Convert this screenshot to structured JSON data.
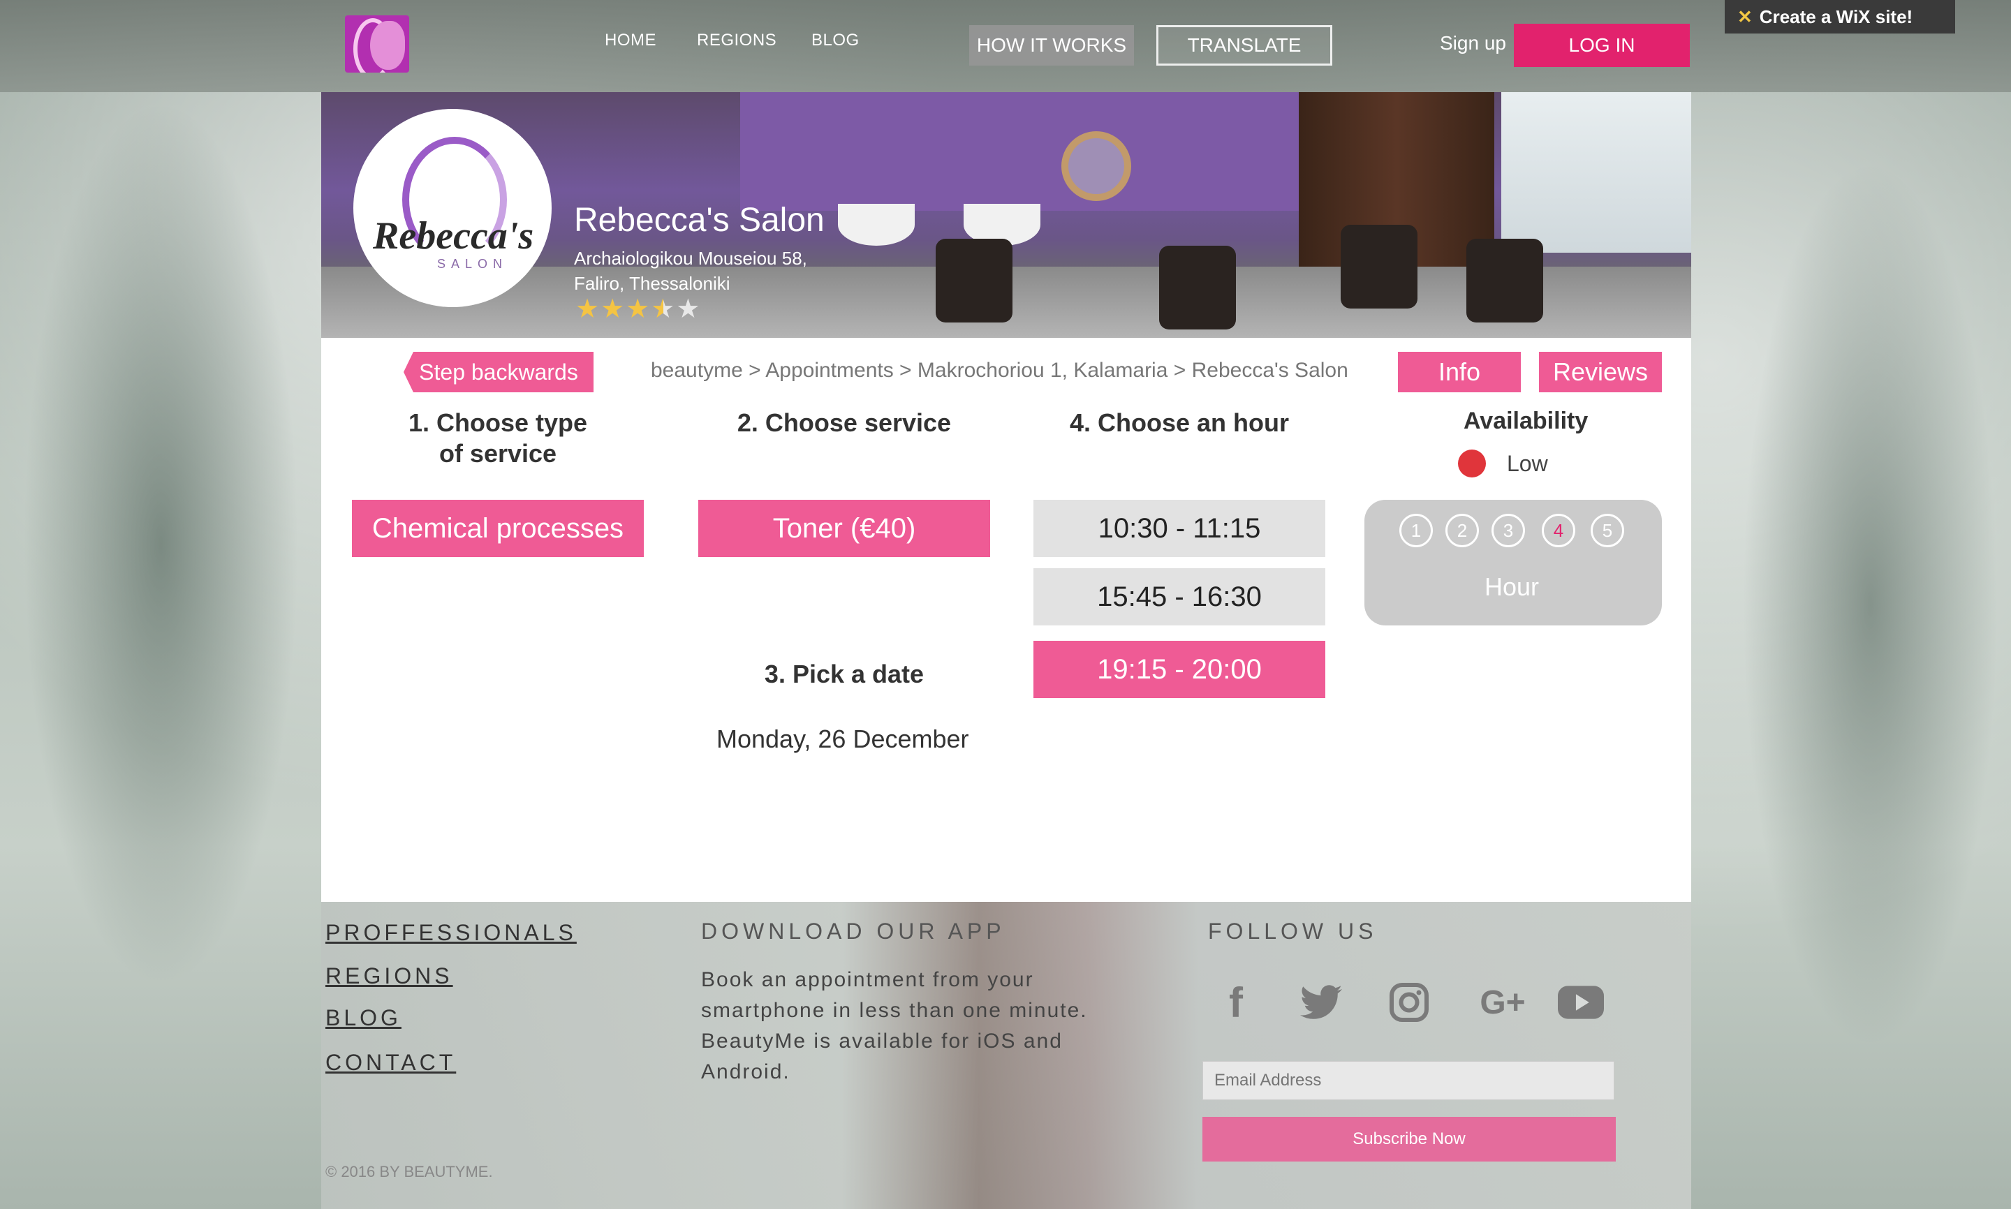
{
  "nav": {
    "links": [
      "HOME",
      "REGIONS",
      "BLOG"
    ],
    "how_it_works": "HOW IT WORKS",
    "translate": "TRANSLATE",
    "sign_up": "Sign up",
    "log_in": "LOG IN",
    "wix_banner": "Create a WiX site!"
  },
  "salon": {
    "logo_text": "Rebecca's",
    "logo_sub": "SALON",
    "name": "Rebecca's Salon",
    "address_line1": "Archaiologikou Mouseiou 58,",
    "address_line2": "Faliro, Thessaloniki",
    "rating": 3.5,
    "rating_max": 5
  },
  "toolbar": {
    "step_back": "Step backwards",
    "breadcrumb": "beautyme > Appointments > Makrochoriou 1, Kalamaria > Rebecca's Salon",
    "info": "Info",
    "reviews": "Reviews"
  },
  "steps": {
    "step1_line1": "1. Choose type",
    "step1_line2": "of service",
    "step1_value": "Chemical processes",
    "step2": "2. Choose service",
    "step2_value": "Toner (€40)",
    "step3": "3. Pick a date",
    "step3_value": "Monday, 26 December",
    "step4": "4. Choose an hour",
    "hours": [
      {
        "label": "10:30 - 11:15",
        "selected": false
      },
      {
        "label": "15:45 - 16:30",
        "selected": false
      },
      {
        "label": "19:15 - 20:00",
        "selected": true
      }
    ]
  },
  "availability": {
    "title": "Availability",
    "level": "Low",
    "level_color": "#e0353b",
    "numbers": [
      "1",
      "2",
      "3",
      "4",
      "5"
    ],
    "active_number": "4",
    "hour_label": "Hour"
  },
  "footer": {
    "links": [
      "PROFFESSIONALS",
      "REGIONS",
      "BLOG",
      "CONTACT"
    ],
    "app_title": "DOWNLOAD OUR APP",
    "app_text": "Book an appointment from your smartphone in less than one minute. BeautyMe is available for iOS and Android.",
    "follow_title": "FOLLOW US",
    "social_icons": [
      "facebook-icon",
      "twitter-icon",
      "instagram-icon",
      "google-plus-icon",
      "youtube-icon"
    ],
    "email_placeholder": "Email Address",
    "subscribe": "Subscribe Now",
    "copyright": "© 2016 BY BEAUTYME."
  },
  "colors": {
    "accent_pink": "#ef5b95",
    "login_pink": "#e2226d",
    "subscribe_pink": "#e46c9c"
  }
}
